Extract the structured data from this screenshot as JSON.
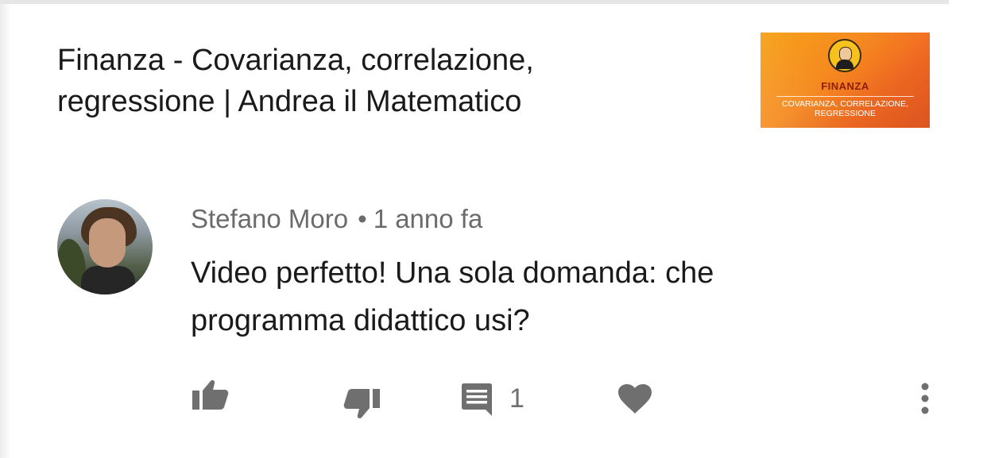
{
  "video": {
    "title": "Finanza - Covarianza, correlazione, regressione | Andrea il Matematico",
    "thumbnail": {
      "heading": "FINANZA",
      "subtitle_line1": "COVARIANZA, CORRELAZIONE,",
      "subtitle_line2": "REGRESSIONE",
      "colors": [
        "#f6a21a",
        "#ef5a23"
      ]
    }
  },
  "comment": {
    "author": "Stefano Moro",
    "separator": "•",
    "time": "1 anno fa",
    "text": "Video perfetto! Una sola domanda: che programma didattico usi?",
    "reply_count": "1"
  },
  "actions": {
    "icons": [
      "thumb-up-icon",
      "thumb-down-icon",
      "comment-icon",
      "heart-icon",
      "more-vert-icon"
    ],
    "icon_color": "#6f6f6f"
  }
}
